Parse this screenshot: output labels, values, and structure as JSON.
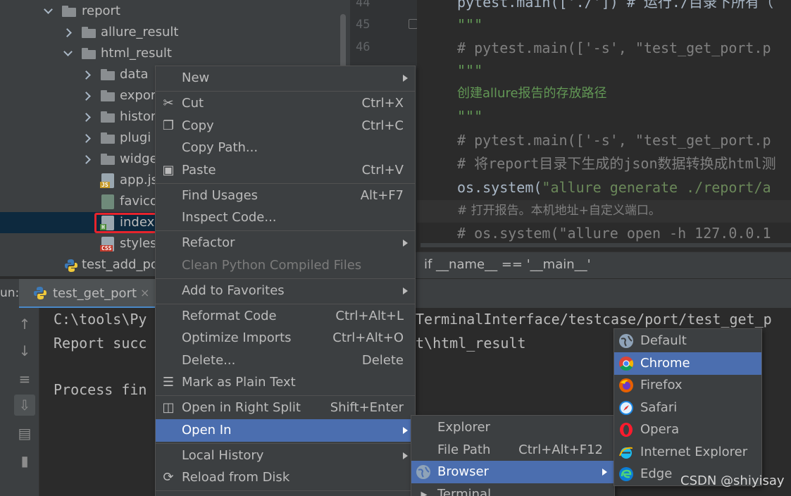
{
  "tree": {
    "items": [
      {
        "label": "report"
      },
      {
        "label": "allure_result"
      },
      {
        "label": "html_result"
      },
      {
        "label": "data"
      },
      {
        "label": "expor"
      },
      {
        "label": "histor"
      },
      {
        "label": "plugi"
      },
      {
        "label": "widge"
      },
      {
        "label": "app.js",
        "tag": "JS"
      },
      {
        "label": "favico"
      },
      {
        "label": "index.",
        "tag": "H"
      },
      {
        "label": "styles.",
        "tag": "CSS"
      },
      {
        "label": "test_add_po"
      }
    ]
  },
  "editor": {
    "line_numbers": [
      "44",
      "45",
      "46"
    ],
    "lines": [
      "pytest.main(['./']) # 运行./目录下所有（",
      "\"\"\"",
      "# pytest.main(['-s', \"test_get_port.p",
      "\"\"\"",
      "创建allure报告的存放路径",
      "\"\"\"",
      "# pytest.main(['-s', \"test_get_port.p",
      "# 将report目录下生成的json数据转换成html测",
      "os.system(",
      "\"allure generate ./report/a",
      "# 打开报告。本机地址+自定义端口。",
      "# os.system(\"allure open -h 127.0.0.1"
    ],
    "breadcrumb": "if __name__ == '__main__'"
  },
  "run_panel": {
    "label": "un:",
    "tab_label": "test_get_port",
    "close": "×",
    "console_lines": [
      "C:\\tools\\Py",
      "TerminalInterface/testcase/port/test_get_p",
      "Report succ",
      "t\\html_result",
      "Process fin"
    ]
  },
  "context_menu": {
    "items": [
      {
        "label": "New",
        "submenu": true
      },
      {
        "label": "Cut",
        "shortcut": "Ctrl+X",
        "icon": "scissors-icon"
      },
      {
        "label": "Copy",
        "shortcut": "Ctrl+C",
        "icon": "copy-icon"
      },
      {
        "label": "Copy Path...",
        "shortcut": ""
      },
      {
        "label": "Paste",
        "shortcut": "Ctrl+V",
        "icon": "paste-icon"
      },
      {
        "label": "Find Usages",
        "shortcut": "Alt+F7"
      },
      {
        "label": "Inspect Code..."
      },
      {
        "label": "Refactor",
        "submenu": true
      },
      {
        "label": "Clean Python Compiled Files",
        "disabled": true
      },
      {
        "label": "Add to Favorites",
        "submenu": true
      },
      {
        "label": "Reformat Code",
        "shortcut": "Ctrl+Alt+L"
      },
      {
        "label": "Optimize Imports",
        "shortcut": "Ctrl+Alt+O"
      },
      {
        "label": "Delete...",
        "shortcut": "Delete"
      },
      {
        "label": "Mark as Plain Text",
        "icon": "plain-text-icon"
      },
      {
        "label": "Open in Right Split",
        "shortcut": "Shift+Enter",
        "icon": "split-icon"
      },
      {
        "label": "Open In",
        "submenu": true,
        "selected": true
      },
      {
        "label": "Local History",
        "submenu": true
      },
      {
        "label": "Reload from Disk",
        "icon": "reload-icon"
      }
    ]
  },
  "open_in_menu": {
    "items": [
      {
        "label": "Explorer"
      },
      {
        "label": "File Path",
        "shortcut": "Ctrl+Alt+F12"
      },
      {
        "label": "Browser",
        "submenu": true,
        "selected": true,
        "icon": "globe-icon"
      },
      {
        "label": "Terminal",
        "icon": "terminal-icon"
      }
    ]
  },
  "browser_menu": {
    "items": [
      {
        "label": "Default",
        "icon": "globe-icon"
      },
      {
        "label": "Chrome",
        "icon": "chrome-icon",
        "selected": true
      },
      {
        "label": "Firefox",
        "icon": "firefox-icon"
      },
      {
        "label": "Safari",
        "icon": "safari-icon"
      },
      {
        "label": "Opera",
        "icon": "opera-icon"
      },
      {
        "label": "Internet Explorer",
        "icon": "internet-explorer-icon"
      },
      {
        "label": "Edge",
        "icon": "edge-icon"
      }
    ]
  },
  "watermark": "CSDN @shiyisay",
  "colors": {
    "selection": "#4b6eaf",
    "menu_bg": "#3c3f41",
    "editor_bg": "#2b2b2b",
    "highlight_box": "#e6242c"
  }
}
